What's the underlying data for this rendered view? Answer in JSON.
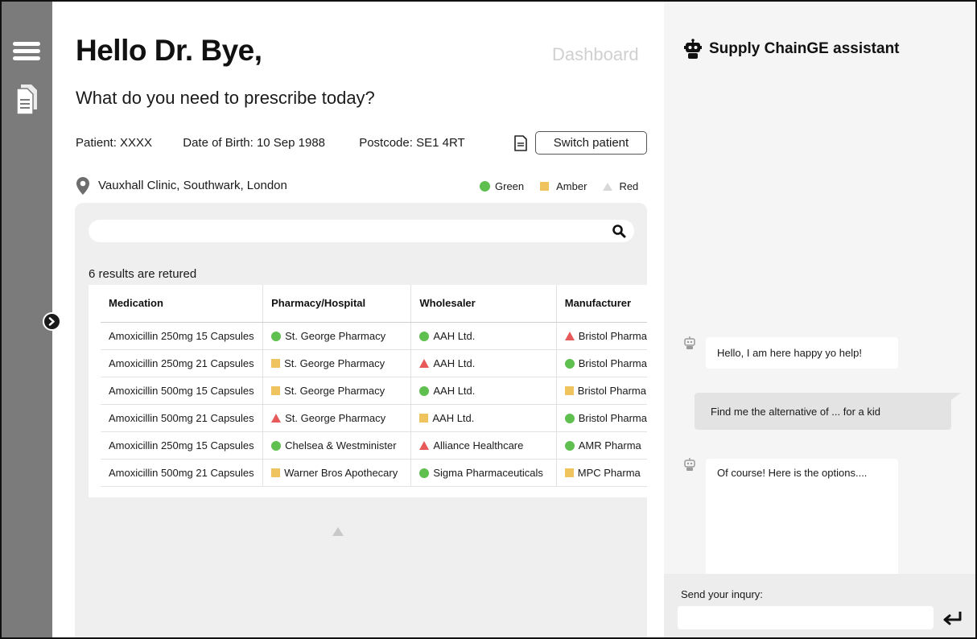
{
  "header": {
    "greeting": "Hello Dr. Bye,",
    "dashboard_link": "Dashboard",
    "subtitle": "What do you need to prescribe today?"
  },
  "patient": {
    "name": "Patient: XXXX",
    "dob": "Date of Birth: 10 Sep 1988",
    "postcode": "Postcode: SE1 4RT",
    "switch_label": "Switch patient"
  },
  "location": "Vauxhall Clinic, Southwark, London",
  "legend": {
    "green": "Green",
    "amber": "Amber",
    "red": "Red",
    "colors": {
      "green": "#5fbf4f",
      "amber": "#efc45e",
      "red": "#e85a5a"
    }
  },
  "search": {
    "placeholder": "",
    "icon": "search-icon"
  },
  "results_count": "6 results are retured",
  "table": {
    "columns": [
      "Medication",
      "Pharmacy/Hospital",
      "Wholesaler",
      "Manufacturer"
    ],
    "rows": [
      {
        "medication": "Amoxicillin 250mg 15 Capsules",
        "pharmacy": "St. George Pharmacy",
        "pharmacy_status": "green",
        "wholesaler": "AAH Ltd.",
        "wholesaler_status": "green",
        "manufacturer": "Bristol Pharma",
        "manufacturer_status": "red"
      },
      {
        "medication": "Amoxicillin 250mg 21 Capsules",
        "pharmacy": "St. George Pharmacy",
        "pharmacy_status": "amber",
        "wholesaler": "AAH Ltd.",
        "wholesaler_status": "red",
        "manufacturer": "Bristol Pharma",
        "manufacturer_status": "green"
      },
      {
        "medication": "Amoxicillin 500mg 15 Capsules",
        "pharmacy": "St. George Pharmacy",
        "pharmacy_status": "amber",
        "wholesaler": "AAH Ltd.",
        "wholesaler_status": "green",
        "manufacturer": "Bristol Pharma",
        "manufacturer_status": "amber"
      },
      {
        "medication": "Amoxicillin 500mg 21 Capsules",
        "pharmacy": "St. George Pharmacy",
        "pharmacy_status": "red",
        "wholesaler": "AAH Ltd.",
        "wholesaler_status": "amber",
        "manufacturer": "Bristol Pharma",
        "manufacturer_status": "green"
      },
      {
        "medication": "Amoxicillin 250mg 15 Capsules",
        "pharmacy": "Chelsea & Westminister",
        "pharmacy_status": "green",
        "wholesaler": "Alliance Healthcare",
        "wholesaler_status": "red",
        "manufacturer": "AMR Pharma",
        "manufacturer_status": "green"
      },
      {
        "medication": "Amoxicillin 500mg 21 Capsules",
        "pharmacy": "Warner Bros Apothecary",
        "pharmacy_status": "amber",
        "wholesaler": "Sigma Pharmaceuticals",
        "wholesaler_status": "green",
        "manufacturer": "MPC Pharma",
        "manufacturer_status": "amber"
      }
    ]
  },
  "assistant": {
    "title": "Supply ChainGE assistant",
    "messages": [
      {
        "from": "bot",
        "text": "Hello, I am here happy yo help!"
      },
      {
        "from": "user",
        "text": "Find me the alternative of ... for a kid"
      },
      {
        "from": "bot",
        "text": "Of course! Here is the options...."
      }
    ],
    "inquiry_label": "Send your inqury:",
    "inquiry_value": ""
  }
}
